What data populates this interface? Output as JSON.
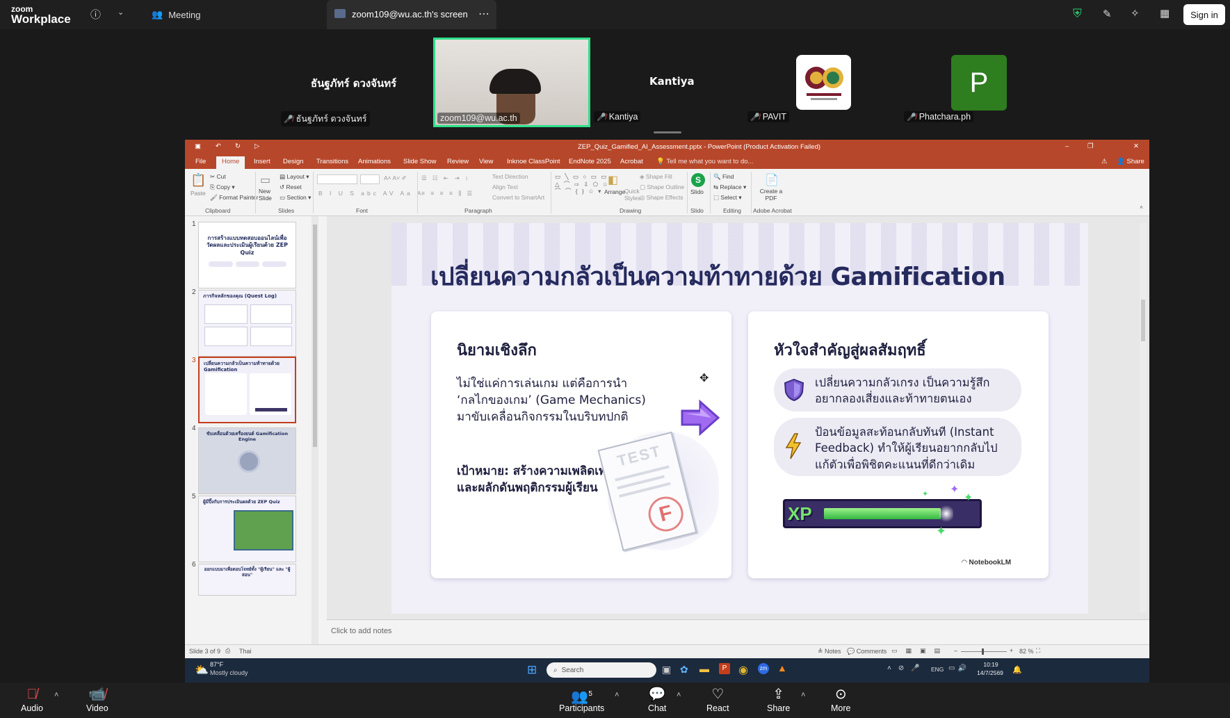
{
  "top_bar": {
    "logo_line1": "zoom",
    "logo_line2": "Workplace",
    "meeting_label": "Meeting",
    "share_tab_label": "zoom109@wu.ac.th's screen",
    "sign_in_label": "Sign in"
  },
  "gallery": {
    "tiles": [
      {
        "display_name": "ธันฐภัทร์ ดวงจันทร์",
        "label": "ธันฐภัทร์ ดวงจันทร์",
        "muted": true
      },
      {
        "display_name": "",
        "label": "zoom109@wu.ac.th",
        "muted": false,
        "video": true
      },
      {
        "display_name": "Kantiya",
        "label": "Kantiya",
        "muted": true
      },
      {
        "display_name": "",
        "label": "PAVIT",
        "muted": true,
        "avatar": "university-seal"
      },
      {
        "display_name": "",
        "label": "Phatchara.ph",
        "muted": true,
        "avatar_letter": "P",
        "avatar_color": "#2e7d1e"
      }
    ]
  },
  "ppt": {
    "title": "ZEP_Quiz_Gamified_AI_Assessment.pptx - PowerPoint (Product Activation Failed)",
    "tabs": [
      "File",
      "Home",
      "Insert",
      "Design",
      "Transitions",
      "Animations",
      "Slide Show",
      "Review",
      "View",
      "Inknoe ClassPoint",
      "EndNote 2025",
      "Acrobat"
    ],
    "tell_me": "Tell me what you want to do...",
    "share": "Share",
    "ribbon": {
      "clipboard": {
        "paste": "Paste",
        "cut": "Cut",
        "copy": "Copy",
        "format_painter": "Format Painter",
        "label": "Clipboard"
      },
      "slides": {
        "new_slide": "New Slide",
        "layout": "Layout",
        "reset": "Reset",
        "section": "Section",
        "label": "Slides"
      },
      "font": {
        "label": "Font"
      },
      "paragraph": {
        "text_direction": "Text Direction",
        "align_text": "Align Text",
        "convert": "Convert to SmartArt",
        "label": "Paragraph"
      },
      "drawing": {
        "arrange": "Arrange",
        "quick_styles": "Quick Styles",
        "shape_fill": "Shape Fill",
        "shape_outline": "Shape Outline",
        "shape_effects": "Shape Effects",
        "label": "Drawing"
      },
      "slido": {
        "btn": "Slido",
        "label": "Slido"
      },
      "editing": {
        "find": "Find",
        "replace": "Replace",
        "select": "Select",
        "label": "Editing"
      },
      "acrobat": {
        "btn": "Create a PDF",
        "label": "Adobe Acrobat"
      }
    },
    "thumbnails": [
      {
        "num": "1",
        "title": "การสร้างแบบทดสอบออนไลน์เพื่อวัดผลและประเมินผู้เรียนด้วย ZEP Quiz"
      },
      {
        "num": "2",
        "title": "ภารกิจหลักของคุณ (Quest Log)"
      },
      {
        "num": "3",
        "title": "เปลี่ยนความกลัวเป็นความท้าทายด้วย Gamification"
      },
      {
        "num": "4",
        "title": "ขับเคลื่อนด้วยเครื่องยนต์ Gamification Engine"
      },
      {
        "num": "5",
        "title": "ผู้มีปิ๊งกับการประเมินผลด้วย ZEP Quiz"
      },
      {
        "num": "6",
        "title": "ออกแบบมาเพื่อตอบโจทย์ทั้ง \"ผู้เรียน\" และ \"ผู้สอน\""
      }
    ],
    "slide": {
      "title": "เปลี่ยนความกลัวเป็นความท้าทายด้วย Gamification",
      "left_card": {
        "heading": "นิยามเชิงลึก",
        "body": "ไม่ใช่แค่การเล่นเกม แต่คือการนำ ‘กลไกของเกม’ (Game Mechanics) มาขับเคลื่อนกิจกรรมในบริบทปกติ",
        "goal": "เป้าหมาย: สร้างความเพลิดเพลิน จูงใจ และผลักดันพฤติกรรมผู้เรียน",
        "paper_word": "TEST",
        "grade": "F"
      },
      "right_card": {
        "heading": "หัวใจสำคัญสู่ผลสัมฤทธิ์",
        "point1": "เปลี่ยนความกลัวเกรง เป็นความรู้สึกอยากลองเสี่ยงและท้าทายตนเอง",
        "point2": "ป้อนข้อมูลสะท้อนกลับทันที (Instant Feedback) ทำให้ผู้เรียนอยากกลับไปแก้ตัวเพื่อพิชิตคะแนนที่ดีกว่าเดิม",
        "xp_label": "XP"
      },
      "watermark": "NotebookLM"
    },
    "notes_placeholder": "Click to add notes",
    "status": {
      "slide_info": "Slide 3 of 9",
      "language": "Thai",
      "notes": "Notes",
      "comments": "Comments",
      "zoom": "82 %"
    }
  },
  "taskbar": {
    "weather_temp": "87°F",
    "weather_desc": "Mostly cloudy",
    "search_placeholder": "Search",
    "lang": "ENG",
    "time": "10:19",
    "date": "14/7/2569"
  },
  "bottom_bar": {
    "audio": "Audio",
    "video": "Video",
    "participants": "Participants",
    "participants_count": "5",
    "chat": "Chat",
    "react": "React",
    "share": "Share",
    "more": "More"
  },
  "colors": {
    "ppt_accent": "#b7472a",
    "zoom_bg": "#1a1a1a",
    "slide_title": "#252a5e",
    "active_speaker_border": "#2fe08a"
  }
}
